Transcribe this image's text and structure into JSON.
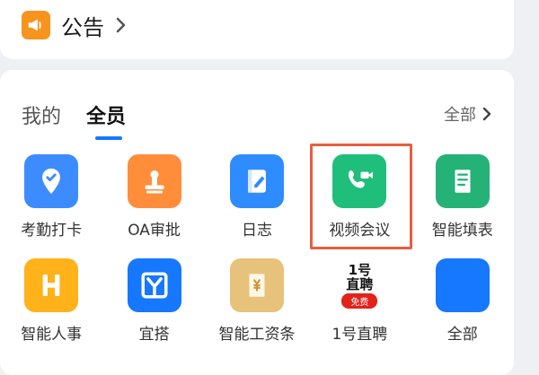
{
  "notice": {
    "label": "公告"
  },
  "tabs": [
    {
      "label": "我的"
    },
    {
      "label": "全员"
    }
  ],
  "all_link": {
    "label": "全部"
  },
  "apps": [
    {
      "label": "考勤打卡",
      "icon": "location-check-icon",
      "color": "#3c8cff"
    },
    {
      "label": "OA审批",
      "icon": "stamp-icon",
      "color": "#ff8d3a"
    },
    {
      "label": "日志",
      "icon": "notebook-pen-icon",
      "color": "#2f8cff"
    },
    {
      "label": "视频会议",
      "icon": "video-call-icon",
      "color": "#1fbe7a"
    },
    {
      "label": "智能填表",
      "icon": "scroll-form-icon",
      "color": "#25b277"
    },
    {
      "label": "智能人事",
      "icon": "h-letter-icon",
      "color": "#ffb21a"
    },
    {
      "label": "宜搭",
      "icon": "y-logo-icon",
      "color": "#1677ff"
    },
    {
      "label": "智能工资条",
      "icon": "salary-slip-icon",
      "color": "#e7c27a"
    },
    {
      "label": "1号直聘",
      "icon": "zhipin-logo-icon",
      "badge_top": "1号",
      "badge_mid": "直聘",
      "badge_bottom": "免费",
      "color": "#e2231a"
    },
    {
      "label": "全部",
      "icon": "all-apps-icon",
      "color": "#1677ff"
    }
  ],
  "colors": {
    "accent": "#1677ff",
    "highlight": "#e95d3f"
  }
}
